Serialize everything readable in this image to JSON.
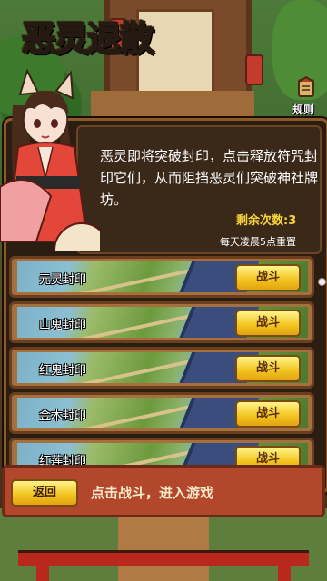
{
  "game": {
    "title": "恶灵退散"
  },
  "rules": {
    "label": "规则"
  },
  "info": {
    "description": "恶灵即将突破封印，点击释放符咒封印它们，从而阻挡恶灵们突破神社牌坊。",
    "remaining_label": "剩余次数:3",
    "reset_note": "每天凌晨5点重置"
  },
  "stages": [
    {
      "name": "元灵封印",
      "button": "战斗"
    },
    {
      "name": "山鬼封印",
      "button": "战斗"
    },
    {
      "name": "红鬼封印",
      "button": "战斗"
    },
    {
      "name": "金木封印",
      "button": "战斗"
    },
    {
      "name": "红莲封印",
      "button": "战斗"
    }
  ],
  "bottom": {
    "back_label": "返回",
    "hint": "点击战斗，进入游戏"
  },
  "colors": {
    "button_gold": "#f2c31d",
    "panel_dark": "#2c1d12",
    "bar_red": "#b3472b",
    "remain_yellow": "#f6d43b"
  }
}
